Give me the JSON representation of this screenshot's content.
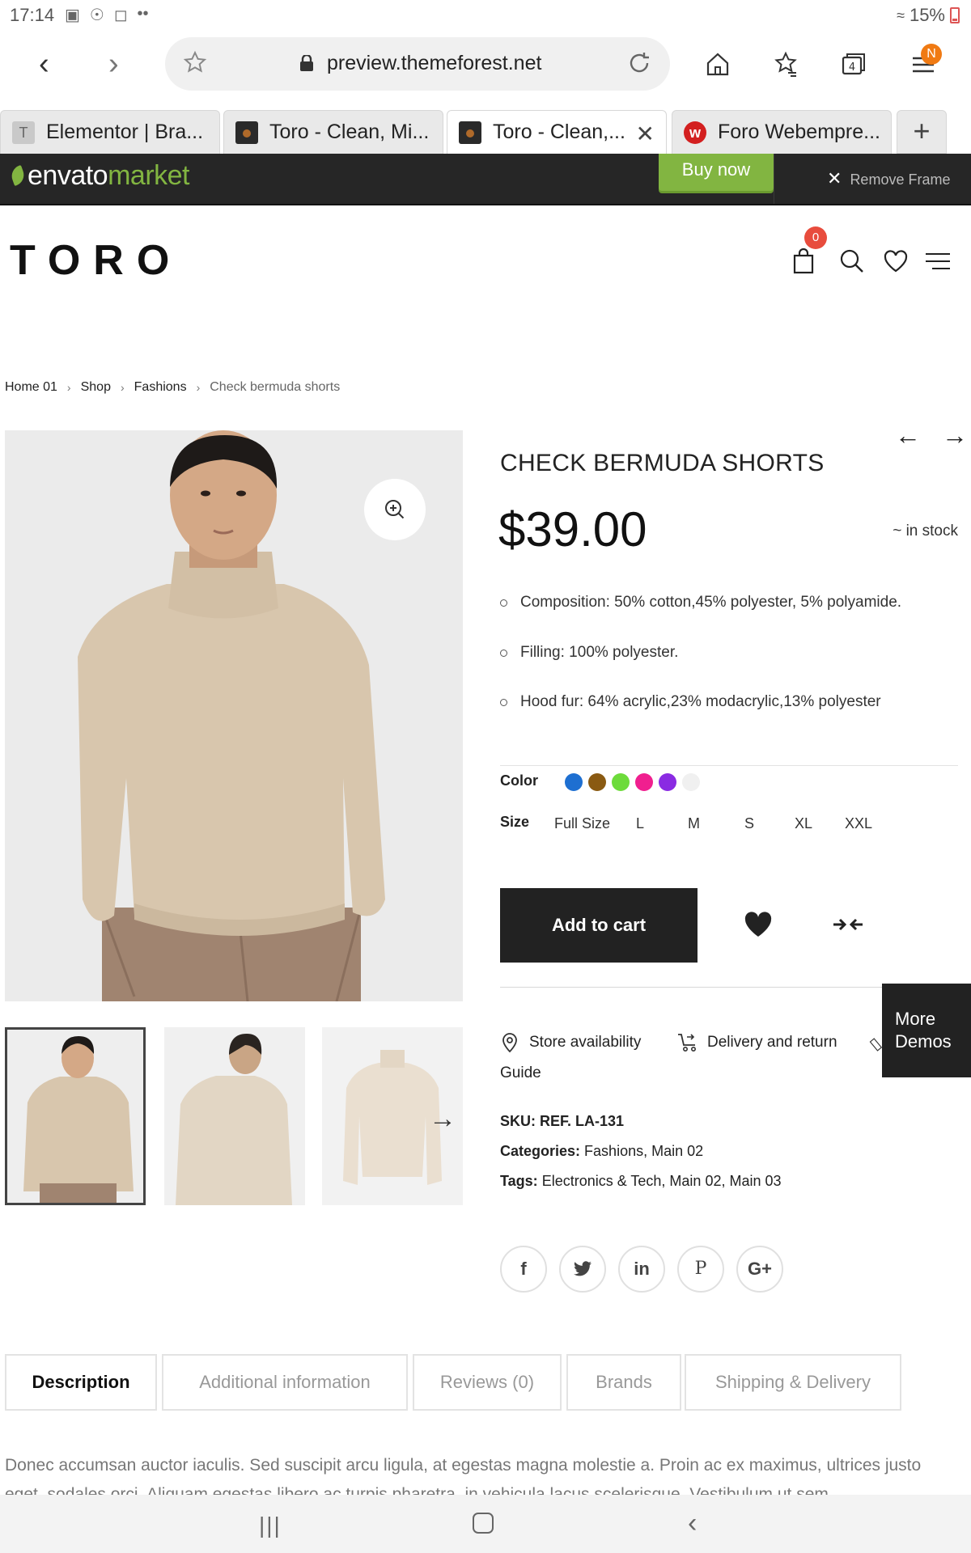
{
  "status": {
    "time": "17:14",
    "battery": "15%",
    "dots": "••"
  },
  "browser": {
    "url": "preview.themeforest.net",
    "notification_badge": "N",
    "tabs": [
      {
        "label": "Elementor | Bra...",
        "favicon": "T"
      },
      {
        "label": "Toro - Clean, Mi...",
        "favicon": ""
      },
      {
        "label": "Toro - Clean,...",
        "favicon": ""
      },
      {
        "label": "Foro Webempre...",
        "favicon": "w"
      }
    ],
    "tab_add": "+"
  },
  "envato": {
    "logo_envato": "envato",
    "logo_market": "market",
    "buy_now": "Buy now",
    "remove_frame": "Remove Frame",
    "remove_x": "✕"
  },
  "site": {
    "logo": "TORO",
    "cart_count": "0"
  },
  "breadcrumb": {
    "items": [
      "Home 01",
      "Shop",
      "Fashions"
    ],
    "current": "Check bermuda shorts",
    "separator": "›"
  },
  "product": {
    "title": "CHECK BERMUDA SHORTS",
    "price": "$39.00",
    "stock": "~ in stock",
    "features": [
      "Composition: 50% cotton,45% polyester, 5% polyamide.",
      "Filling: 100% polyester.",
      "Hood fur: 64% acrylic,23% modacrylic,13% polyester"
    ],
    "color_label": "Color",
    "colors": [
      "#1e6fd1",
      "#8a5a12",
      "#6ddb3b",
      "#f01f8f",
      "#8a2be2",
      "#f0f0f0"
    ],
    "size_label": "Size",
    "sizes": [
      "Full Size",
      "L",
      "M",
      "S",
      "XL",
      "XXL"
    ],
    "add_to_cart": "Add to cart",
    "store_availability": "Store availability",
    "delivery_return": "Delivery and return",
    "guide": "Guide",
    "more_demos": [
      "More",
      "Demos"
    ],
    "sku_label": "SKU:",
    "sku": "REF. LA-131",
    "categories_label": "Categories:",
    "categories": "Fashions, Main 02",
    "tags_label": "Tags:",
    "tags": "Electronics & Tech, Main 02, Main 03",
    "social": [
      "f",
      "t",
      "in",
      "P",
      "G+"
    ]
  },
  "tabs": [
    "Description",
    "Additional information",
    "Reviews (0)",
    "Brands",
    "Shipping & Delivery"
  ],
  "description": "Donec accumsan auctor iaculis. Sed suscipit arcu ligula, at egestas magna molestie a. Proin ac ex maximus, ultrices justo eget, sodales orci. Aliquam egestas libero ac turpis pharetra, in vehicula lacus scelerisque. Vestibulum ut sem"
}
